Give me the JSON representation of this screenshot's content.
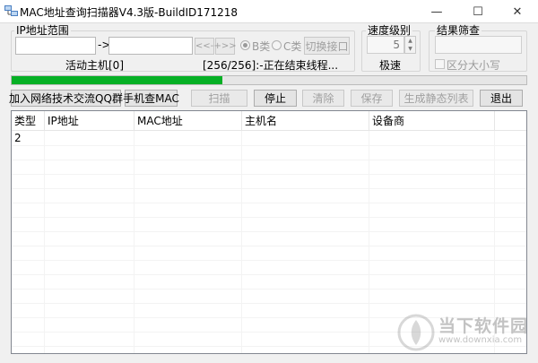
{
  "window": {
    "title": "MAC地址查询扫描器V4.3版-BuildID171218",
    "icon": "network-app-icon",
    "controls": {
      "minimize": "—",
      "maximize": "☐",
      "close": "✕"
    }
  },
  "ip_range": {
    "group_title": "IP地址范围",
    "start_ip": "",
    "arrow": "->",
    "end_ip": "",
    "prev_label": "<<-",
    "next_label": "+>>",
    "class_b_label": "B类",
    "class_c_label": "C类",
    "selected_class": "B类",
    "switch_nic_label": "切换接口",
    "active_hosts_label": "活动主机[0]",
    "status_text": "[256/256]:-正在结束线程..."
  },
  "speed": {
    "group_title": "速度级别",
    "value": "5",
    "level_text": "极速"
  },
  "filter": {
    "group_title": "结果筛查",
    "input_value": "",
    "case_sensitive_label": "区分大小写",
    "case_sensitive_checked": false
  },
  "progress": {
    "value": 0.41,
    "color": "#06b025"
  },
  "toolbar": {
    "join_qq_label": "加入网络技术交流QQ群",
    "phone_mac_label": "手机查MAC",
    "scan_label": "扫描",
    "stop_label": "停止",
    "clear_label": "清除",
    "save_label": "保存",
    "gen_static_label": "生成静态列表",
    "exit_label": "退出"
  },
  "table": {
    "columns": [
      "类型",
      "IP地址",
      "MAC地址",
      "主机名",
      "设备商"
    ],
    "rows": [
      [
        "2",
        "",
        "",
        "",
        ""
      ]
    ]
  },
  "watermark": {
    "text": "当下软件园",
    "url": "www.downxia.com"
  }
}
